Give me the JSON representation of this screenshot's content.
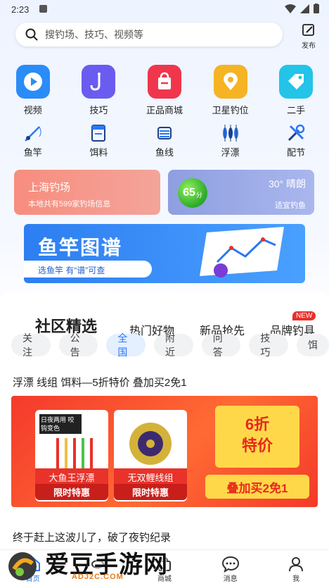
{
  "status": {
    "time": "2:23"
  },
  "search": {
    "placeholder": "搜钓场、技巧、视频等",
    "publish_label": "发布"
  },
  "top_icons": [
    {
      "label": "视频",
      "icon": "video-play-icon",
      "color": "#2a8cf7"
    },
    {
      "label": "技巧",
      "icon": "fishing-hook-icon",
      "color": "#6a5cf0"
    },
    {
      "label": "正品商城",
      "icon": "shopping-bag-icon",
      "color": "#f0364c"
    },
    {
      "label": "卫星钓位",
      "icon": "location-pin-icon",
      "color": "#f6b323"
    },
    {
      "label": "二手",
      "icon": "tag-icon",
      "color": "#23c4e8"
    }
  ],
  "gear_icons": [
    {
      "label": "鱼竿",
      "icon": "fishing-rod-icon"
    },
    {
      "label": "饵料",
      "icon": "bait-icon"
    },
    {
      "label": "鱼线",
      "icon": "fishing-line-icon"
    },
    {
      "label": "浮漂",
      "icon": "float-icon"
    },
    {
      "label": "配节",
      "icon": "tools-icon"
    }
  ],
  "spot_card": {
    "title": "上海钓场",
    "subtitle": "本地共有599家钓场信息"
  },
  "weather_card": {
    "score": "65",
    "score_unit": "分",
    "weather": "30° 晴朗",
    "fishing": "适宜钓鱼"
  },
  "banner": {
    "title": "鱼竿图谱",
    "subtitle": "选鱼竿 有“谱”可查"
  },
  "community": {
    "tabs": [
      "社区精选",
      "热门好物",
      "新品抢先",
      "品牌钓具"
    ],
    "new_badge": "NEW",
    "chips": [
      "关注",
      "公告",
      "全国",
      "附近",
      "问答",
      "技巧",
      "饵"
    ],
    "active_chip": "全国",
    "post1_title": "浮漂 线组 饵料—5折特价 叠加买2免1",
    "promo": {
      "product1_name": "大鱼王浮漂",
      "product1_tag": "限时特惠",
      "product1_note": "日夜两用 咬钩变色",
      "product2_name": "无双鲤线组",
      "product2_tag": "限时特惠",
      "sale_line1": "6折",
      "sale_line2": "特价",
      "buy": "叠加买2免1"
    },
    "post2_title": "终于赶上这波儿了，破了夜钓纪录"
  },
  "nav": [
    {
      "label": "首页",
      "icon": "home-icon",
      "active": true
    },
    {
      "label": "",
      "icon": "fish-icon",
      "active": false
    },
    {
      "label": "商城",
      "icon": "shop-icon",
      "active": false
    },
    {
      "label": "消息",
      "icon": "message-icon",
      "active": false
    },
    {
      "label": "我",
      "icon": "user-icon",
      "active": false
    }
  ],
  "watermark": {
    "text": "爱豆手游网",
    "url": "ADJ2C.COM"
  },
  "colors": {
    "accent": "#2a78f0",
    "promo_red": "#f43a2c",
    "promo_yellow": "#ffd84a"
  }
}
